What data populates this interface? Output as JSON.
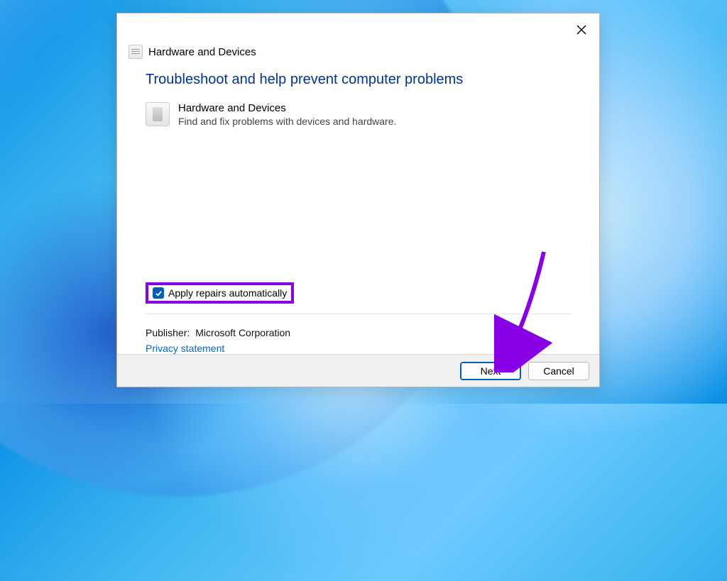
{
  "header": {
    "title": "Hardware and Devices"
  },
  "content": {
    "heading": "Troubleshoot and help prevent computer problems",
    "troubleshooter": {
      "title": "Hardware and Devices",
      "description": "Find and fix problems with devices and hardware."
    },
    "apply_repairs_label": "Apply repairs automatically",
    "apply_repairs_checked": true,
    "publisher_label": "Publisher:",
    "publisher_value": "Microsoft Corporation",
    "privacy_link": "Privacy statement"
  },
  "buttons": {
    "next": "Next",
    "cancel": "Cancel"
  },
  "annotations": {
    "highlight_color": "#8a00e6"
  }
}
